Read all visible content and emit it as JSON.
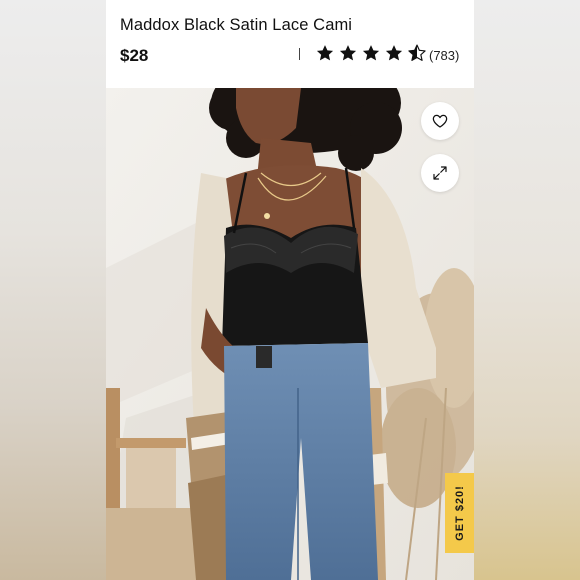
{
  "product": {
    "title": "Maddox Black Satin Lace Cami",
    "price": "$28",
    "rating_stars": 4.5,
    "rating_count": "(783)"
  },
  "actions": {
    "like_icon": "heart-icon",
    "expand_icon": "expand-icon"
  },
  "promo": {
    "label": "GET $20!",
    "color": "#f4c94a"
  },
  "colors": {
    "star": "#111111",
    "text": "#111111"
  }
}
